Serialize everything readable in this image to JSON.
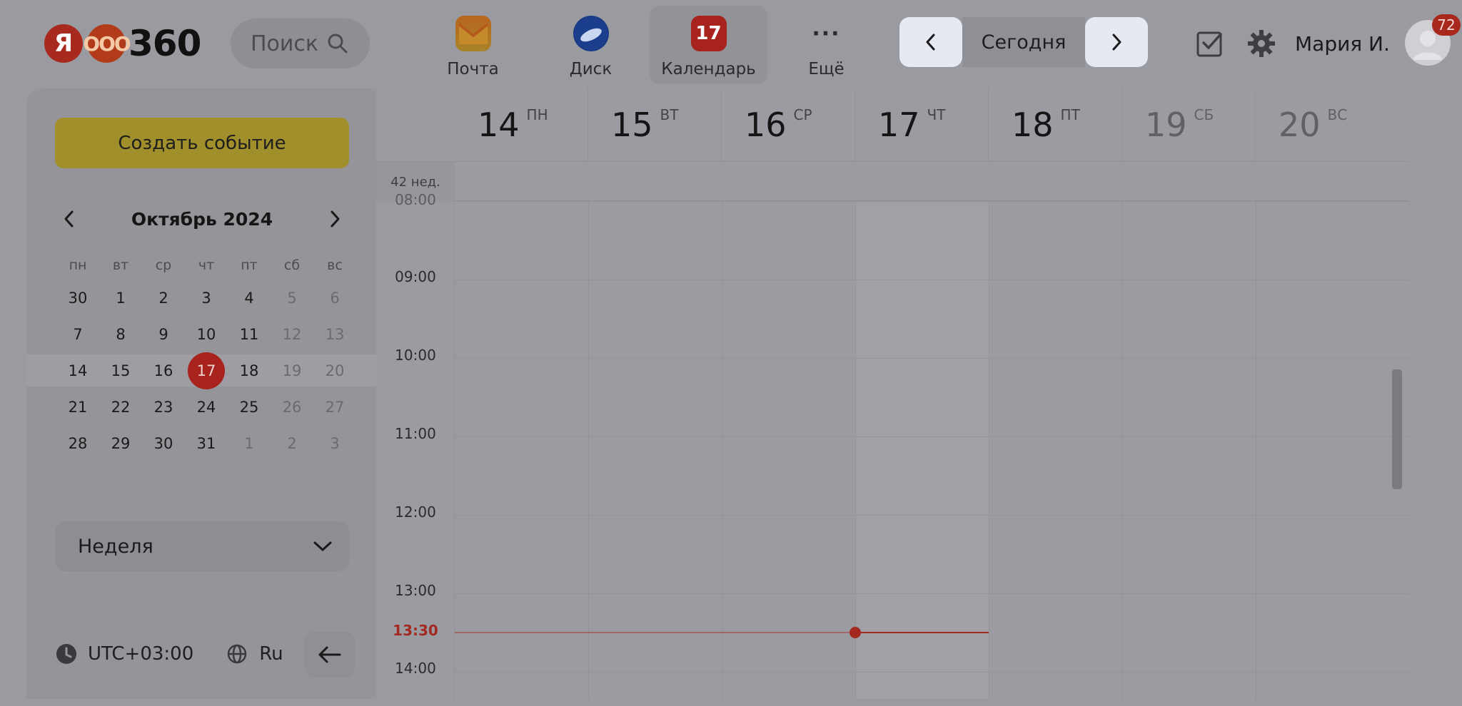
{
  "header": {
    "logo": {
      "letter": "Я",
      "mid": "ООО",
      "number": "360"
    },
    "search_label": "Поиск",
    "apps": [
      {
        "label": "Почта",
        "icon": "mail-icon"
      },
      {
        "label": "Диск",
        "icon": "disk-icon"
      },
      {
        "label": "Календарь",
        "icon": "calendar-icon",
        "icon_text": "17",
        "active": true
      },
      {
        "label": "Ещё",
        "icon": "more-icon",
        "icon_text": "···"
      }
    ],
    "today_label": "Сегодня",
    "user_name": "Мария И.",
    "notification_count": "72"
  },
  "sidebar": {
    "create_event_label": "Создать событие",
    "month_title": "Октябрь 2024",
    "weekdays": [
      "пн",
      "вт",
      "ср",
      "чт",
      "пт",
      "сб",
      "вс"
    ],
    "weeks": [
      [
        "30",
        "1",
        "2",
        "3",
        "4",
        "5",
        "6"
      ],
      [
        "7",
        "8",
        "9",
        "10",
        "11",
        "12",
        "13"
      ],
      [
        "14",
        "15",
        "16",
        "17",
        "18",
        "19",
        "20"
      ],
      [
        "21",
        "22",
        "23",
        "24",
        "25",
        "26",
        "27"
      ],
      [
        "28",
        "29",
        "30",
        "31",
        "1",
        "2",
        "3"
      ]
    ],
    "today_day": "17",
    "view_label": "Неделя",
    "timezone": "UTC+03:00",
    "language": "Ru"
  },
  "week_view": {
    "week_label": "42 нед.",
    "days": [
      {
        "num": "14",
        "name": "ПН"
      },
      {
        "num": "15",
        "name": "ВТ"
      },
      {
        "num": "16",
        "name": "СР"
      },
      {
        "num": "17",
        "name": "ЧТ"
      },
      {
        "num": "18",
        "name": "ПТ"
      },
      {
        "num": "19",
        "name": "СБ",
        "weekend": true
      },
      {
        "num": "20",
        "name": "ВС",
        "weekend": true
      }
    ],
    "hours": [
      "09:00",
      "10:00",
      "11:00",
      "12:00",
      "13:00",
      "14:00"
    ],
    "partial_hour": "08:00",
    "current_time": "13:30",
    "today_index": 3
  },
  "colors": {
    "accent_red": "#a8231e",
    "create_button": "#a08f2a",
    "nav_button": "#e6e8f2"
  }
}
